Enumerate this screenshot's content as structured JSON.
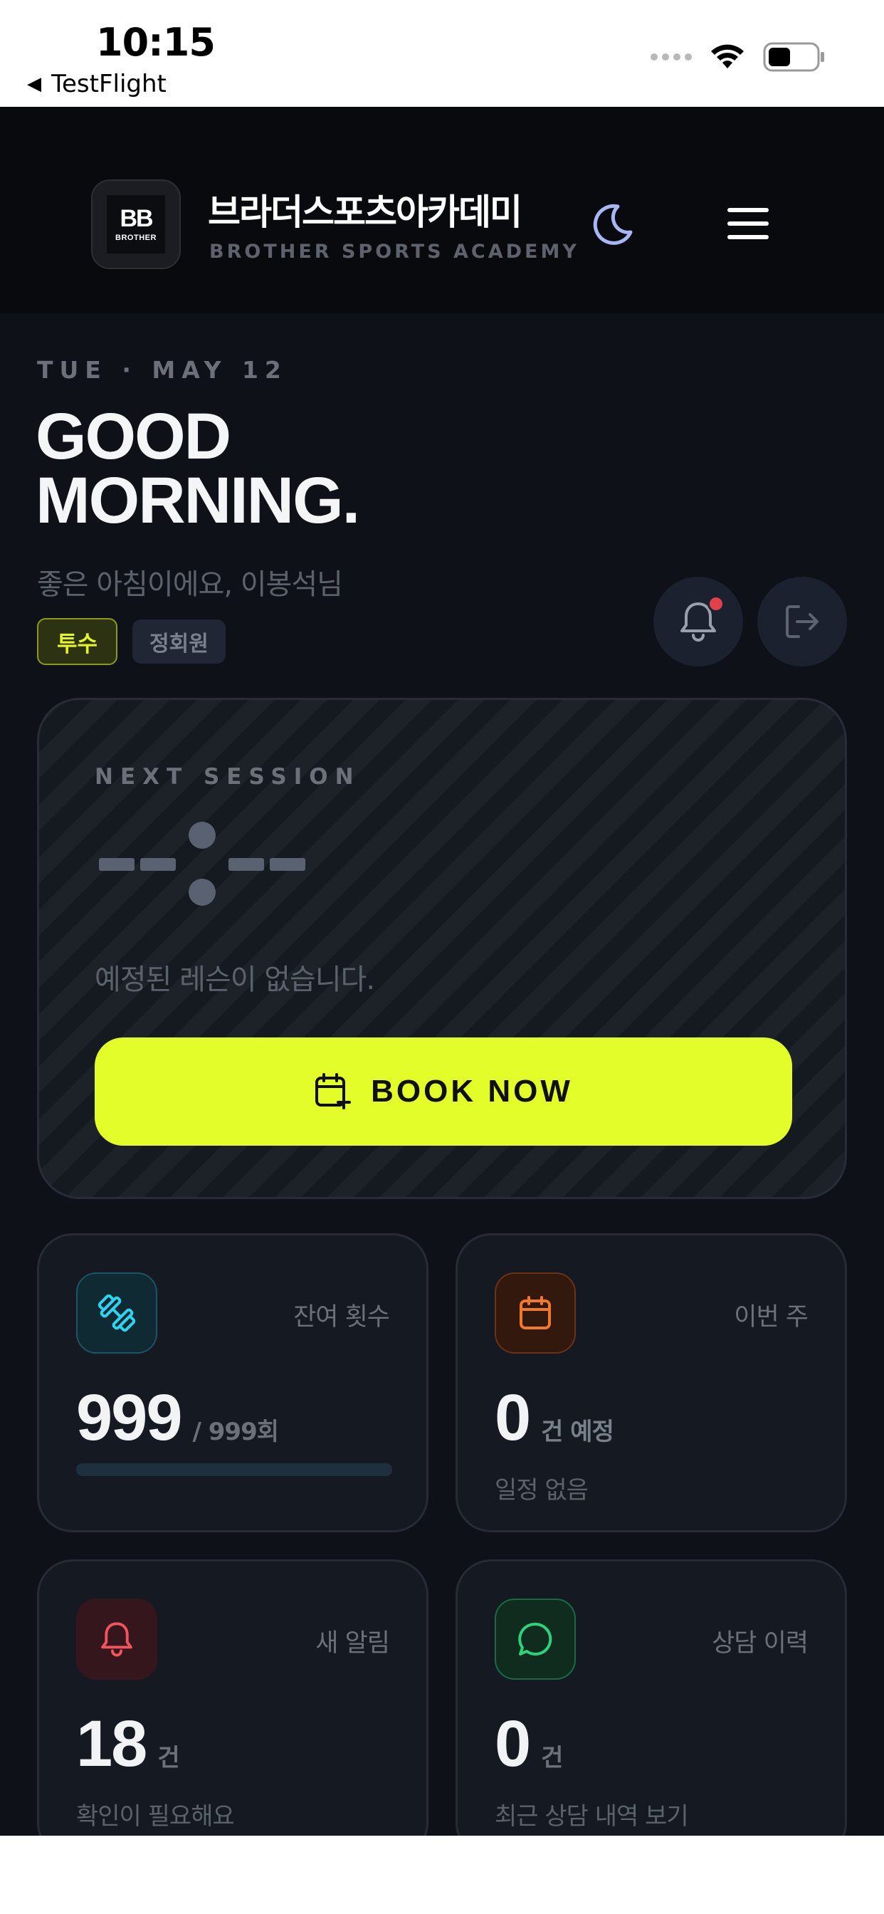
{
  "status_bar": {
    "time": "10:15",
    "back_app": "TestFlight"
  },
  "header": {
    "logo_mark": "BB",
    "logo_word": "BROTHER",
    "title": "브라더스포츠아카데미",
    "subtitle": "BROTHER SPORTS ACADEMY",
    "theme_icon": "moon-icon",
    "menu_icon": "hamburger-menu-icon"
  },
  "greeting": {
    "date": "TUE · MAY 12",
    "headline_line1": "GOOD",
    "headline_line2": "MORNING.",
    "sub": "좋은 아침이에요, 이봉석님",
    "tags": [
      "투수",
      "정회원"
    ],
    "has_unread_notification": true
  },
  "next_session": {
    "label": "NEXT SESSION",
    "time_placeholder": "--:--",
    "empty_text": "예정된 레슨이 없습니다.",
    "book_label": "BOOK NOW"
  },
  "stats": [
    {
      "label": "잔여 횟수",
      "value": "999",
      "unit": "/ 999회",
      "sub": "",
      "icon": "dumbbell-icon",
      "progress": 1.0
    },
    {
      "label": "이번 주",
      "value": "0",
      "unit": "건 예정",
      "sub": "일정 없음",
      "icon": "calendar-icon"
    },
    {
      "label": "새 알림",
      "value": "18",
      "unit": "건",
      "sub": "확인이 필요해요",
      "icon": "bell-icon"
    },
    {
      "label": "상담 이력",
      "value": "0",
      "unit": "건",
      "sub": "최근 상담 내역 보기",
      "icon": "chat-bubble-icon"
    }
  ],
  "colors": {
    "accent": "#e2fd2a",
    "background": "#0e1117",
    "card": "#151922",
    "cyan": "#2fd3f0",
    "orange": "#f07a2a",
    "red": "#f0545e",
    "green": "#2fd27a"
  }
}
